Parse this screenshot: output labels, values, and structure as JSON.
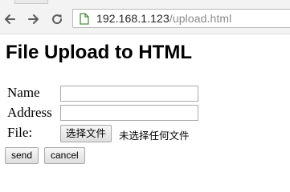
{
  "browser": {
    "url_host": "192.168.1.123",
    "url_path": "/upload.html",
    "secure_icon_color": "#4a8e3c"
  },
  "page": {
    "title": "File Upload to HTML",
    "form": {
      "name_label": "Name",
      "name_value": "",
      "address_label": "Address",
      "address_value": "",
      "file_label": "File:",
      "choose_file_label": "选择文件",
      "no_file_text": "未选择任何文件",
      "send_label": "send",
      "cancel_label": "cancel"
    }
  }
}
